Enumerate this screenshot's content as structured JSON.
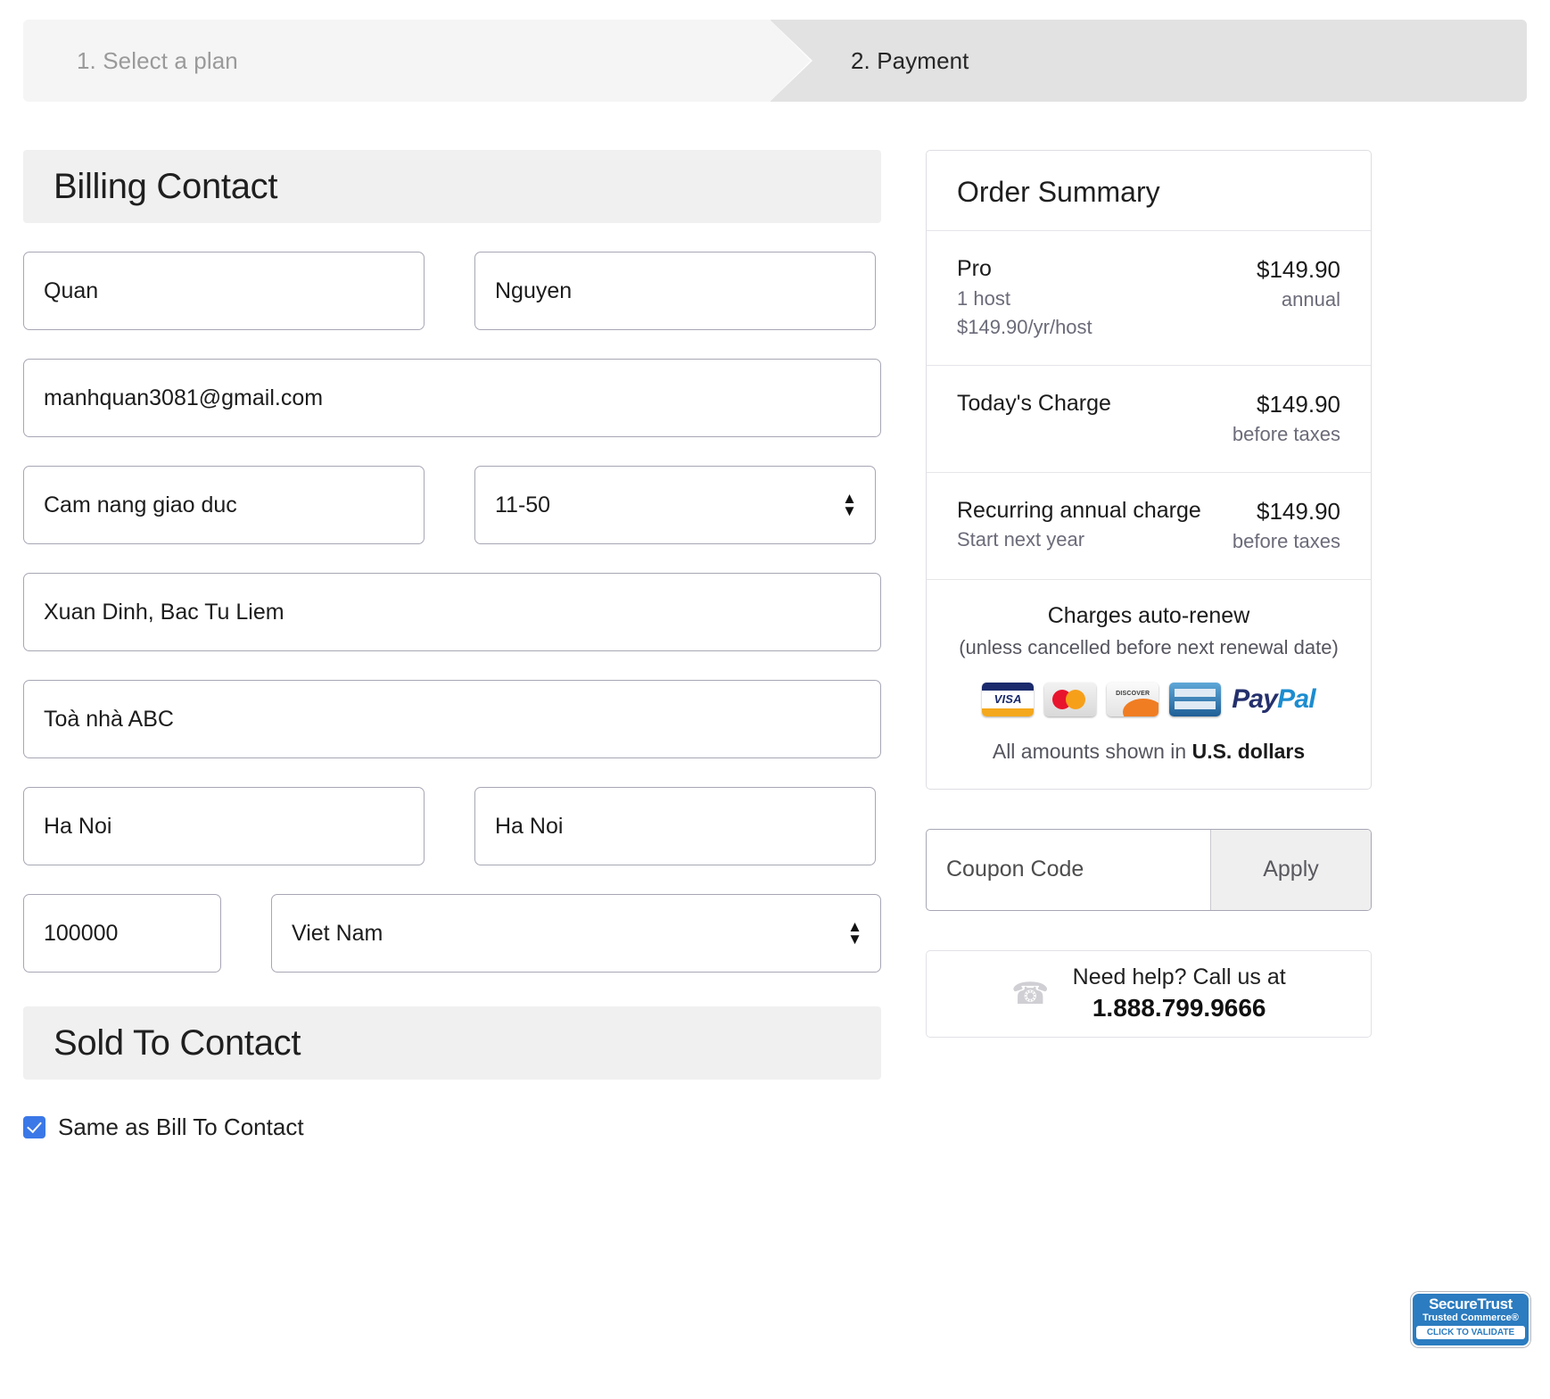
{
  "steps": [
    {
      "label": "1. Select a plan",
      "active": false
    },
    {
      "label": "2. Payment",
      "active": true
    }
  ],
  "billing": {
    "heading": "Billing Contact",
    "first_name": "Quan",
    "last_name": "Nguyen",
    "email": "manhquan3081@gmail.com",
    "company": "Cam nang giao duc",
    "company_size": "11-50",
    "address_1": "Xuan Dinh, Bac Tu Liem",
    "address_2": "Toà nhà ABC",
    "city": "Ha Noi",
    "state": "Ha Noi",
    "zip": "100000",
    "country": "Viet Nam"
  },
  "sold_to": {
    "heading": "Sold To Contact",
    "same_as_bill_label": "Same as Bill To Contact",
    "same_as_bill_checked": true
  },
  "order_summary": {
    "title": "Order Summary",
    "plan": {
      "name": "Pro",
      "hosts": "1 host",
      "unit_price": "$149.90/yr/host",
      "price": "$149.90",
      "term": "annual"
    },
    "today": {
      "label": "Today's Charge",
      "price": "$149.90",
      "note": "before taxes"
    },
    "recurring": {
      "label": "Recurring annual charge",
      "sub": "Start next year",
      "price": "$149.90",
      "note": "before taxes"
    },
    "auto_renew_line1": "Charges auto-renew",
    "auto_renew_line2": "(unless cancelled before next renewal date)",
    "payment_methods": [
      "VISA",
      "MasterCard",
      "Discover",
      "American Express",
      "PayPal"
    ],
    "currency_prefix": "All amounts shown in ",
    "currency_value": "U.S. dollars"
  },
  "coupon": {
    "placeholder": "Coupon Code",
    "apply_label": "Apply"
  },
  "help": {
    "line1": "Need help? Call us at",
    "phone": "1.888.799.9666"
  },
  "trust_badge": {
    "line1": "SecureTrust",
    "line2": "Trusted Commerce®",
    "line3": "CLICK TO VALIDATE"
  },
  "paypal": {
    "part1": "Pay",
    "part2": "Pal"
  }
}
